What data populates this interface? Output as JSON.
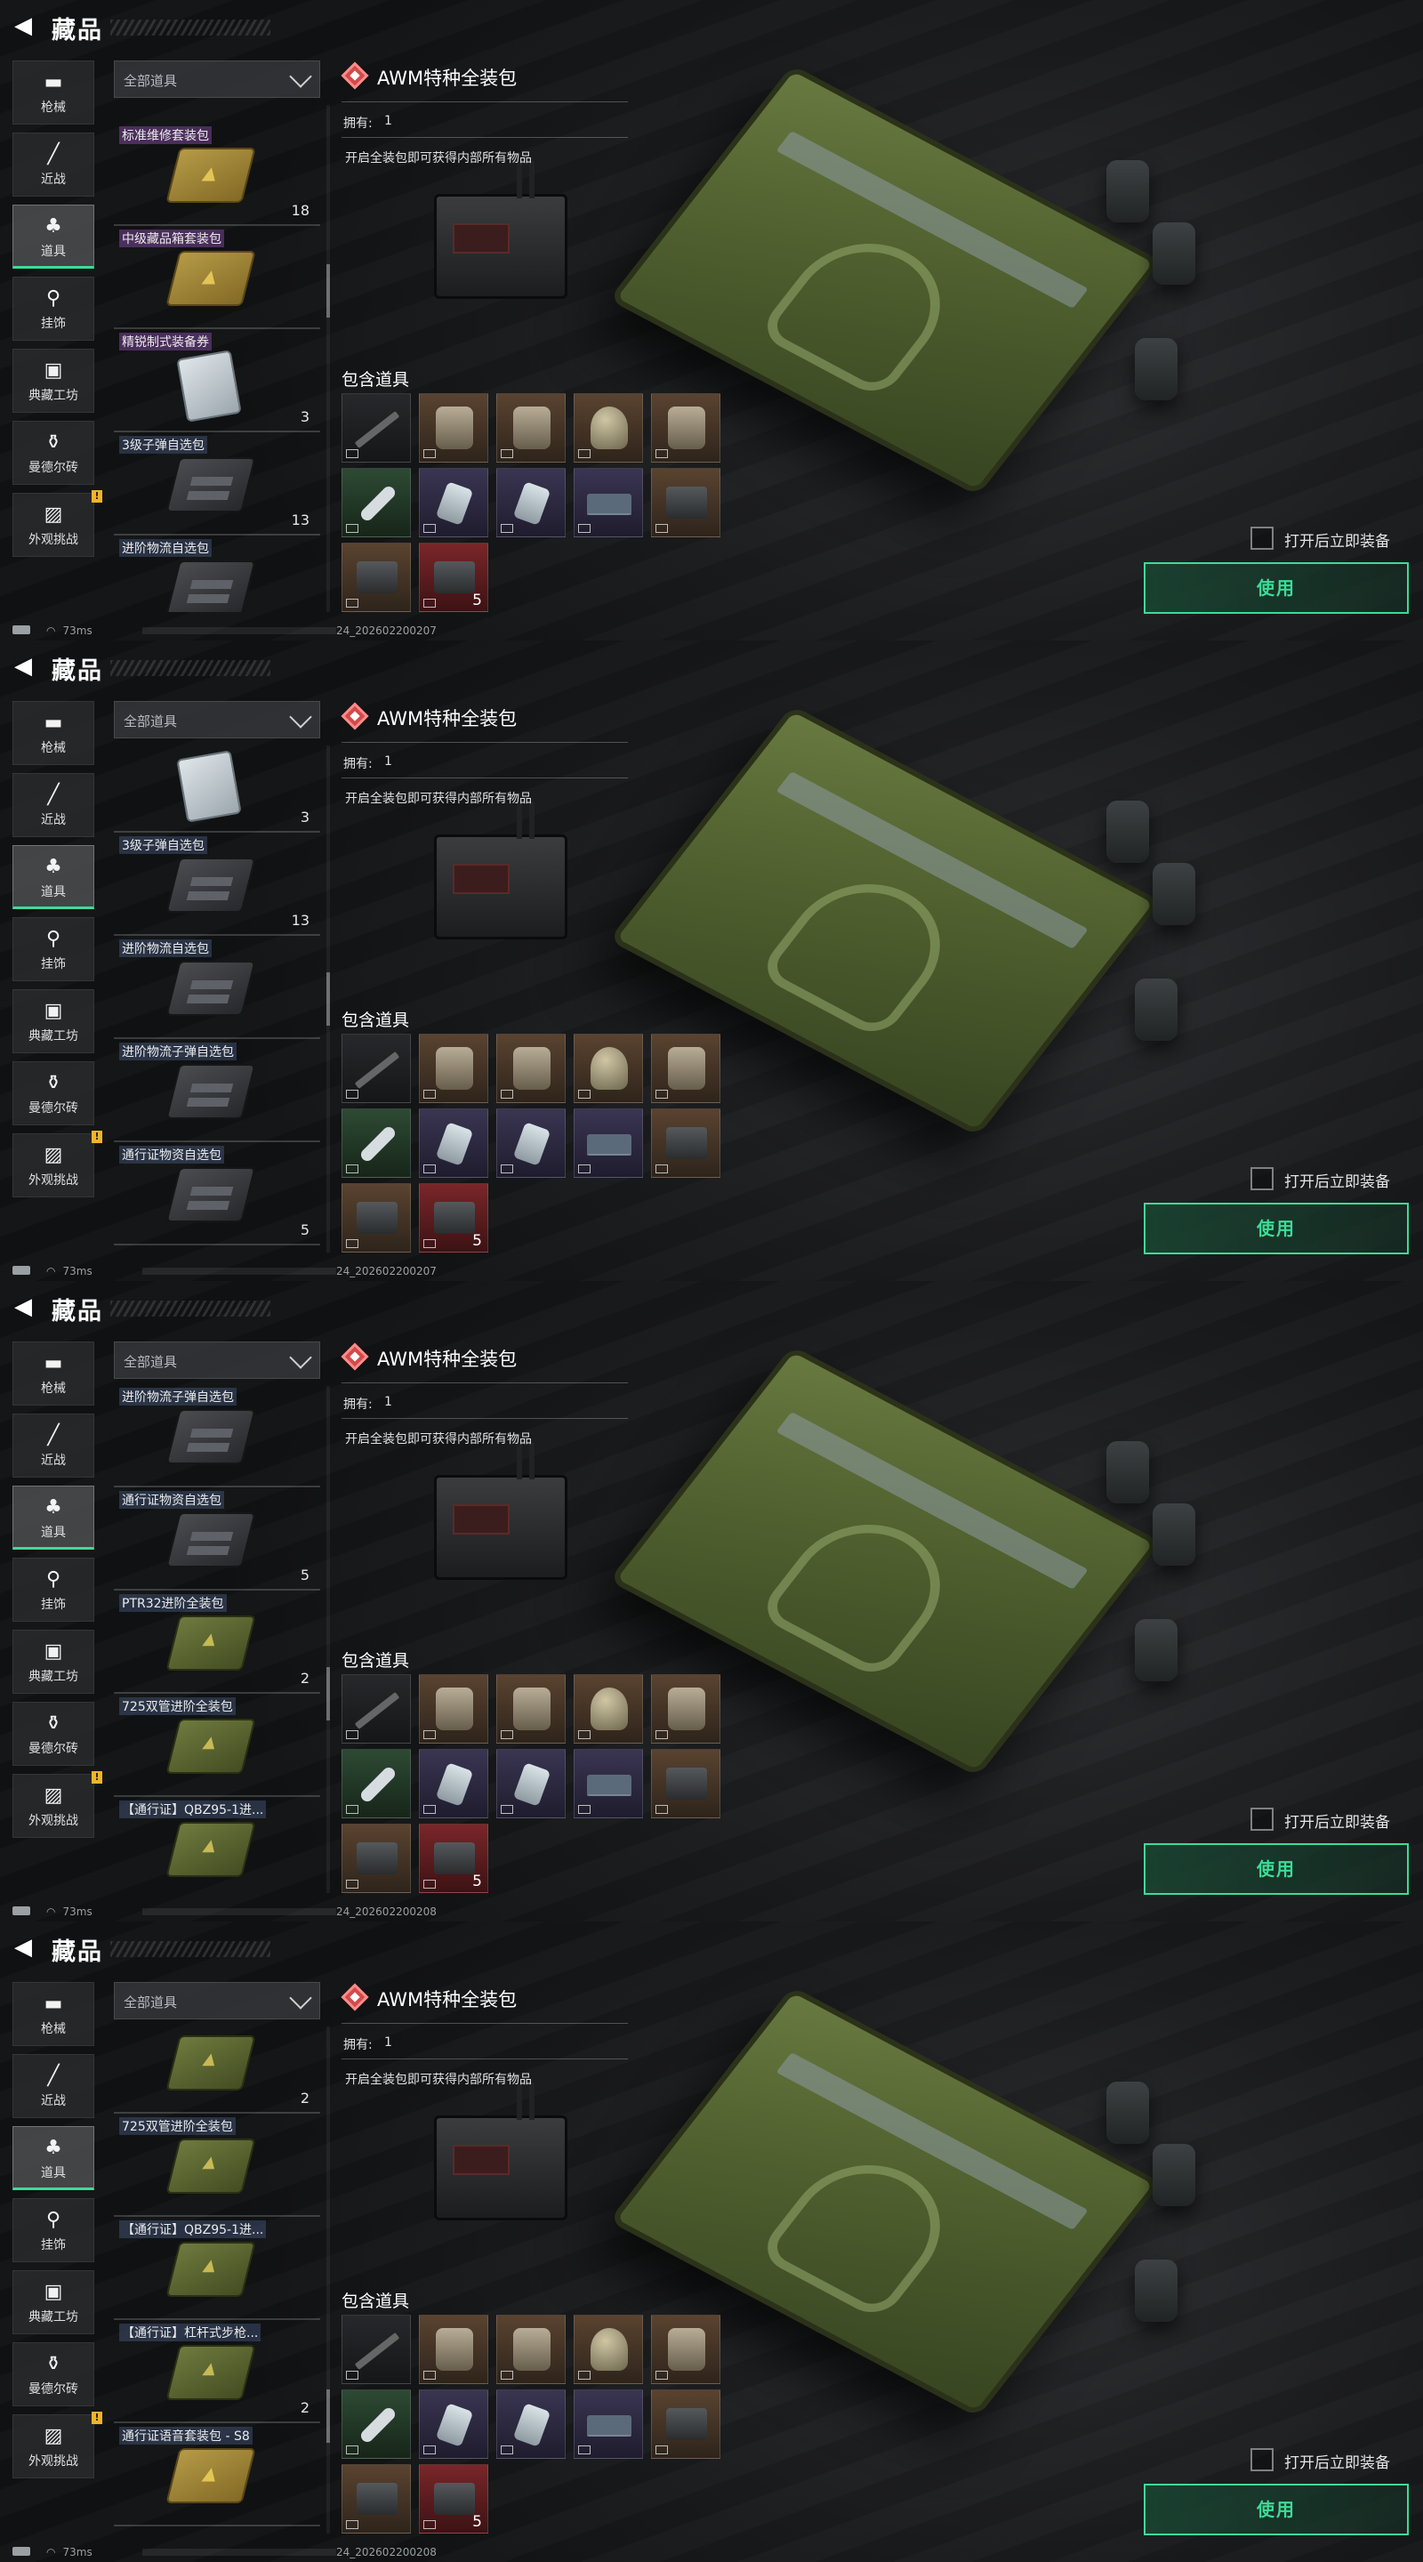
{
  "header": {
    "title": "藏品"
  },
  "nav": [
    {
      "label": "枪械",
      "icon": "gun-icon",
      "glyph": "▬"
    },
    {
      "label": "近战",
      "icon": "knife-icon",
      "glyph": "╱"
    },
    {
      "label": "道具",
      "icon": "items-icon",
      "glyph": "♣",
      "active": true
    },
    {
      "label": "挂饰",
      "icon": "charm-icon",
      "glyph": "⚲"
    },
    {
      "label": "典藏工坊",
      "icon": "workshop-icon",
      "glyph": "▣"
    },
    {
      "label": "曼德尔砖",
      "icon": "brick-icon",
      "glyph": "⚱"
    },
    {
      "label": "外观挑战",
      "icon": "challenge-icon",
      "glyph": "▨",
      "badge": "!"
    }
  ],
  "filter": {
    "label": "全部道具"
  },
  "detail": {
    "title": "AWM特种全装包",
    "owned_label": "拥有:",
    "owned_value": "1",
    "description": "开启全装包即可获得内部所有物品",
    "contents_label": "包含道具",
    "contents": [
      {
        "color": "gray",
        "art": "rifle",
        "icon": "rifle-icon"
      },
      {
        "color": "brown",
        "art": "bag",
        "icon": "backpack-icon"
      },
      {
        "color": "brown",
        "art": "bag",
        "icon": "vest-icon"
      },
      {
        "color": "brown",
        "art": "helmet",
        "icon": "helmet-icon"
      },
      {
        "color": "brown",
        "art": "bag",
        "icon": "armor-icon"
      },
      {
        "color": "green",
        "art": "pill",
        "icon": "syringe-icon"
      },
      {
        "color": "purple",
        "art": "tube",
        "icon": "bandage-icon"
      },
      {
        "color": "purple",
        "art": "tube",
        "icon": "medkit-icon"
      },
      {
        "color": "purple",
        "art": "card",
        "icon": "keycard-icon"
      },
      {
        "color": "brown",
        "art": "box",
        "icon": "battery-icon"
      },
      {
        "color": "brown",
        "art": "box",
        "icon": "case-icon"
      },
      {
        "color": "red",
        "art": "box",
        "icon": "ammo-box-icon",
        "count": "5"
      }
    ],
    "equip_after_open": "打开后立即装备",
    "use_button": "使用"
  },
  "status": {
    "ping": "73ms"
  },
  "frames": [
    {
      "build": "24_20260220​0207",
      "scroll_thumb": 0.35,
      "items": [
        {
          "label": "标准维修套装包",
          "thumb": "gold",
          "count": "18",
          "tint": "purple"
        },
        {
          "label": "中级藏品箱套装包",
          "thumb": "gold",
          "count": "",
          "tint": "purple"
        },
        {
          "label": "精锐制式装备券",
          "thumb": "white",
          "count": "3",
          "tint": "purple"
        },
        {
          "label": "3级子弹自选包",
          "thumb": "dark",
          "count": "13",
          "tint": "blue"
        },
        {
          "label": "进阶物流自选包",
          "thumb": "dark",
          "count": "",
          "tint": "blue"
        }
      ],
      "offset": 20
    },
    {
      "build": "24_20260220​0207",
      "scroll_thumb": 0.5,
      "items": [
        {
          "label": "",
          "thumb": "white",
          "count": "3",
          "tint": "purple"
        },
        {
          "label": "3级子弹自选包",
          "thumb": "dark",
          "count": "13",
          "tint": "blue"
        },
        {
          "label": "进阶物流自选包",
          "thumb": "dark",
          "count": "",
          "tint": "blue"
        },
        {
          "label": "进阶物流子弹自选包",
          "thumb": "dark",
          "count": "",
          "tint": "blue"
        },
        {
          "label": "通行证物资自选包",
          "thumb": "dark",
          "count": "5",
          "tint": "blue"
        }
      ],
      "offset": -18
    },
    {
      "build": "24_20260220​0208",
      "scroll_thumb": 0.62,
      "items": [
        {
          "label": "进阶物流子弹自选包",
          "thumb": "dark",
          "count": "",
          "tint": "blue"
        },
        {
          "label": "通行证物资自选包",
          "thumb": "dark",
          "count": "5",
          "tint": "blue"
        },
        {
          "label": "PTR32进阶全装包",
          "thumb": "green",
          "count": "2",
          "tint": "blue"
        },
        {
          "label": "725双管进阶全装包",
          "thumb": "green",
          "count": "",
          "tint": "blue"
        },
        {
          "label": "【通行证】QBZ95-1进...",
          "thumb": "green",
          "count": "",
          "tint": "blue"
        }
      ],
      "offset": -2
    },
    {
      "build": "24_20260220​0208",
      "scroll_thumb": 0.8,
      "items": [
        {
          "label": "",
          "thumb": "green",
          "count": "2",
          "tint": "blue"
        },
        {
          "label": "725双管进阶全装包",
          "thumb": "green",
          "count": "",
          "tint": "blue"
        },
        {
          "label": "【通行证】QBZ95-1进...",
          "thumb": "green",
          "count": "",
          "tint": "blue"
        },
        {
          "label": "【通行证】杠杆式步枪...",
          "thumb": "green",
          "count": "2",
          "tint": "blue"
        },
        {
          "label": "通行证语音套装包 - S8",
          "thumb": "gold",
          "count": "",
          "tint": "blue"
        }
      ],
      "offset": -18
    }
  ]
}
